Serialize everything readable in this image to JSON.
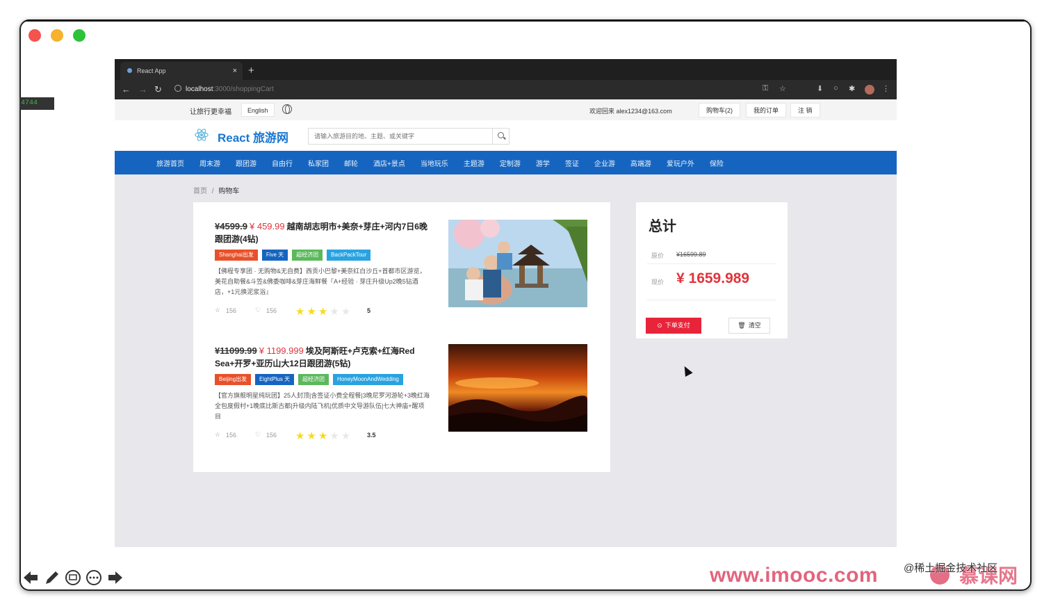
{
  "side_tag": "4744",
  "browser": {
    "tab_title": "React App",
    "tab_close": "×",
    "new_tab": "+",
    "url_host": "localhost",
    "url_path": ":3000/shoppingCart"
  },
  "topbar": {
    "slogan": "让旅行更幸福",
    "language": "English",
    "welcome": "欢迎回来 alex1234@163.com",
    "cart": "购物车(2)",
    "orders": "我的订单",
    "logout": "注 销"
  },
  "header": {
    "brand": "React 旅游网",
    "search_placeholder": "请输入旅游目的地、主题、或关键字"
  },
  "menu": [
    "旅游首页",
    "周末游",
    "跟团游",
    "自由行",
    "私家团",
    "邮轮",
    "酒店+景点",
    "当地玩乐",
    "主题游",
    "定制游",
    "游学",
    "签证",
    "企业游",
    "高端游",
    "爱玩户外",
    "保险"
  ],
  "breadcrumb": {
    "home": "首页",
    "sep": "/",
    "current": "购物车"
  },
  "cart_items": [
    {
      "old_price": "¥4599.9",
      "new_price": "¥ 459.99",
      "title": "越南胡志明市+美奈+芽庄+河内7日6晚跟团游(4钻)",
      "tags": [
        {
          "label": "Shanghai出发",
          "color": "#e8502a"
        },
        {
          "label": "Five 天",
          "color": "#1565c0"
        },
        {
          "label": "超经济团",
          "color": "#5cb85c"
        },
        {
          "label": "BackPackTour",
          "color": "#29a3e0"
        }
      ],
      "description": "【佛程专享团 · 无购物&无自费】西贡小巴黎+美奈红白沙丘+首都市区游览，美花自助餐&斗笠&佛委咖啡&芽庄海鲜餐『A+经验 · 芽庄升级Up2晚5钻酒店，+1元换泥浆浴』",
      "favorites": "156",
      "likes": "156",
      "rating": "5",
      "stars_filled": 3,
      "stars_empty": 2
    },
    {
      "old_price": "¥11099.99",
      "new_price": "¥ 1199.999",
      "title": "埃及阿斯旺+卢克索+红海Red Sea+开罗+亚历山大12日跟团游(5钻)",
      "tags": [
        {
          "label": "Beijing出发",
          "color": "#e8502a"
        },
        {
          "label": "EightPlus 天",
          "color": "#1565c0"
        },
        {
          "label": "超经济团",
          "color": "#5cb85c"
        },
        {
          "label": "HoneyMoonAndWedding",
          "color": "#29a3e0"
        }
      ],
      "description": "【官方旗舰明星纯玩团】25人封顶|含签证小费全程餐|3晚尼罗河游轮+3晚红海全包度假村+1晚底比斯古都|升级内陆飞机|优质中文导游队伍|七大神庙+醒项目",
      "favorites": "156",
      "likes": "156",
      "rating": "3.5",
      "stars_filled": 3,
      "stars_empty": 2
    }
  ],
  "summary": {
    "title": "总计",
    "orig_label": "原价",
    "orig_value": "¥16599.89",
    "now_label": "现价",
    "now_value": "¥ 1659.989",
    "pay_button": "下单支付",
    "clear_button": "清空"
  },
  "watermark": "www.imooc.com",
  "brand_cn": "慕课网",
  "credit": "@稀土掘金技术社区",
  "colors": {
    "accent_blue": "#1565c0",
    "price_red": "#e0343b",
    "pay_red": "#e8243a"
  },
  "icons": [
    "back-arrow-icon",
    "forward-arrow-icon",
    "reload-icon",
    "star-outline-icon",
    "like-icon",
    "star-icon",
    "pencil-icon",
    "globe-icon",
    "search-icon",
    "cart-pay-icon",
    "trash-icon"
  ]
}
